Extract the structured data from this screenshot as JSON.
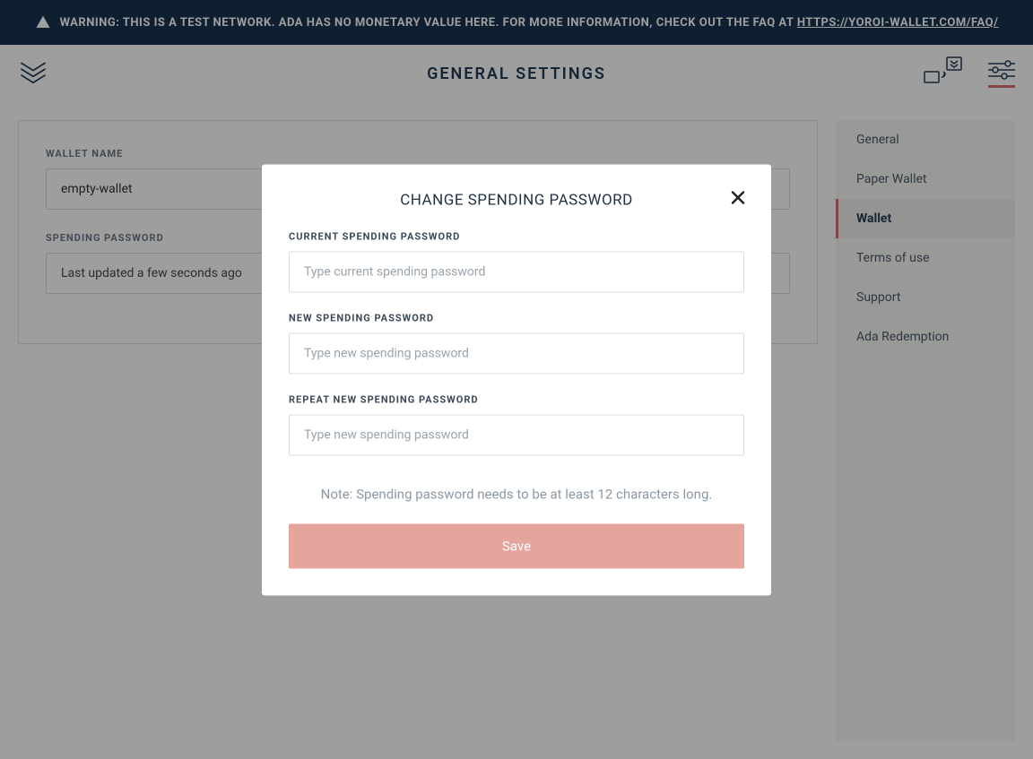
{
  "banner": {
    "text_prefix": "WARNING: THIS IS A TEST NETWORK. ADA HAS NO MONETARY VALUE HERE. FOR MORE INFORMATION, CHECK OUT THE FAQ AT ",
    "link_text": "HTTPS://YOROI-WALLET.COM/FAQ/"
  },
  "header": {
    "title": "GENERAL SETTINGS"
  },
  "content": {
    "wallet_name_label": "WALLET NAME",
    "wallet_name_value": "empty-wallet",
    "spending_password_label": "SPENDING PASSWORD",
    "spending_password_value": "Last updated a few seconds ago"
  },
  "sidebar": {
    "items": [
      {
        "label": "General",
        "active": false
      },
      {
        "label": "Paper Wallet",
        "active": false
      },
      {
        "label": "Wallet",
        "active": true
      },
      {
        "label": "Terms of use",
        "active": false
      },
      {
        "label": "Support",
        "active": false
      },
      {
        "label": "Ada Redemption",
        "active": false
      }
    ]
  },
  "modal": {
    "title": "CHANGE SPENDING PASSWORD",
    "current_label": "CURRENT SPENDING PASSWORD",
    "current_placeholder": "Type current spending password",
    "new_label": "NEW SPENDING PASSWORD",
    "new_placeholder": "Type new spending password",
    "repeat_label": "REPEAT NEW SPENDING PASSWORD",
    "repeat_placeholder": "Type new spending password",
    "note": "Note: Spending password needs to be at least 12 characters long.",
    "save_label": "Save"
  }
}
